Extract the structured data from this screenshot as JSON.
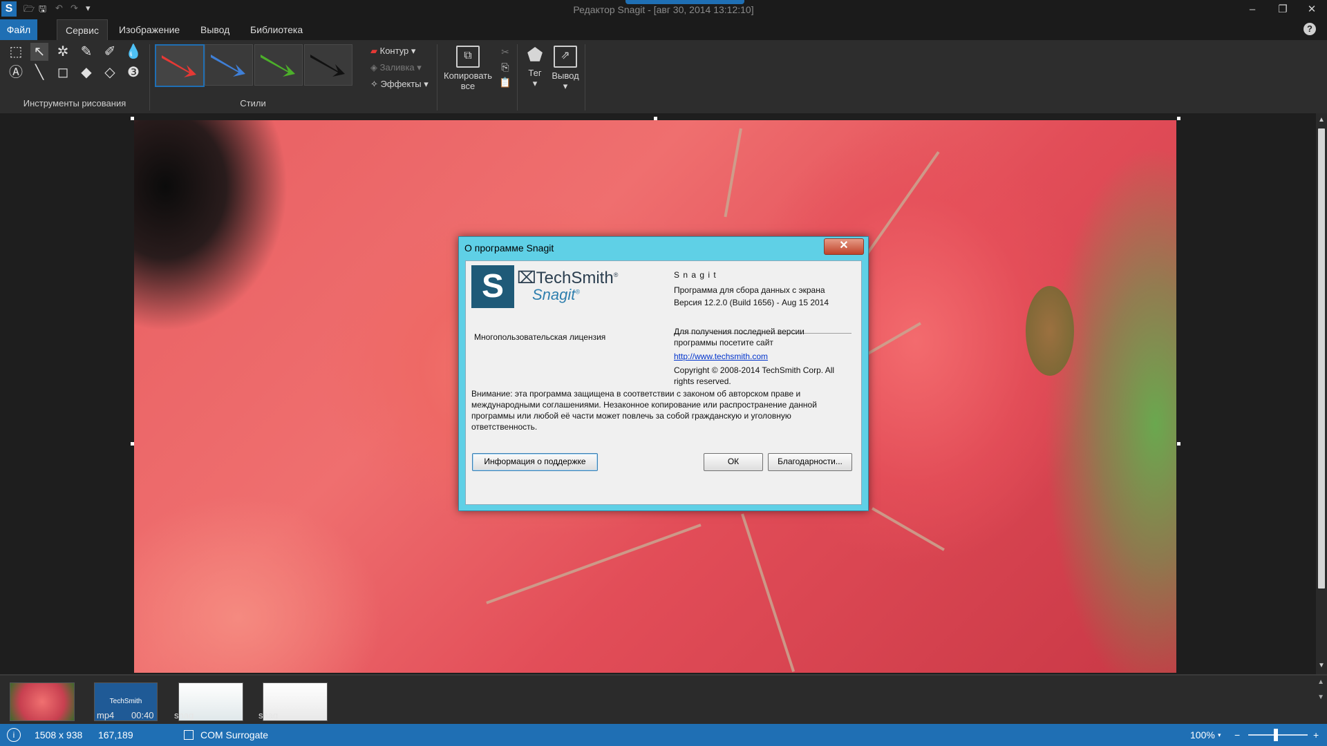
{
  "window": {
    "title": "Редактор Snagit - [авг 30, 2014 13:12:10]",
    "app_icon": "S",
    "quick_access": [
      "open-icon",
      "save-icon",
      "undo-icon",
      "redo-icon",
      "customize-icon"
    ],
    "controls": {
      "minimize": "–",
      "restore": "❐",
      "close": "✕"
    }
  },
  "menu": {
    "tabs": [
      "Файл",
      "Сервис",
      "Изображение",
      "Вывод",
      "Библиотека"
    ],
    "active": "Сервис",
    "help": "?"
  },
  "ribbon": {
    "drawing_tools_label": "Инструменты рисования",
    "drawing_tools": [
      "selection-icon",
      "arrow-icon",
      "stamp-icon",
      "pen-icon",
      "highlighter-icon",
      "blur-icon",
      "callout-icon",
      "line-icon",
      "shape-icon",
      "fill-icon",
      "eraser-icon",
      "step-icon"
    ],
    "styles_label": "Стили",
    "styles": [
      {
        "name": "red-arrow",
        "color": "#e53935"
      },
      {
        "name": "blue-arrow",
        "color": "#3f7fd6"
      },
      {
        "name": "green-arrow",
        "color": "#4caf2a"
      },
      {
        "name": "black-arrow",
        "color": "#111111"
      }
    ],
    "contour_label": "Контур",
    "fill_label": "Заливка",
    "effects_label": "Эффекты",
    "copy_all_label_1": "Копировать",
    "copy_all_label_2": "все",
    "tag_label": "Тег",
    "output_label": "Вывод"
  },
  "dialog": {
    "title": "О программе Snagit",
    "close": "✕",
    "logo_s": "S",
    "logo_company": "TechSmith",
    "logo_product": "Snagit",
    "product_name": "S n a g i t",
    "description": "Программа для сбора данных с экрана",
    "version": "Версия 12.2.0 (Build 1656) - Aug 15 2014",
    "license": "Многопользовательская лицензия",
    "latest_version_line1": "Для получения последней версии",
    "latest_version_line2": "программы посетите сайт",
    "url": "http://www.techsmith.com",
    "copyright_line1": "Copyright © 2008-2014 TechSmith Corp. All",
    "copyright_line2": "rights reserved.",
    "warning_line1": "Внимание: эта программа защищена в соответствии с законом об авторском праве и",
    "warning_line2": "международными соглашениями. Незаконное копирование или распространение данной",
    "warning_line3": "программы или любой её части может повлечь за собой гражданскую и уголовную",
    "warning_line4": "ответственность.",
    "support_button": "Информация о поддержке",
    "ok_button": "ОК",
    "thanks_button": "Благодарности..."
  },
  "tray": {
    "items": [
      {
        "label": "",
        "kind": "image"
      },
      {
        "label": "mp4",
        "duration": "00:40",
        "brand": "TechSmith"
      },
      {
        "label": "snag"
      },
      {
        "label": "snag"
      }
    ]
  },
  "status": {
    "info_icon": "i",
    "dimensions": "1508 x 938",
    "cursor": "167,189",
    "process": "COM Surrogate",
    "zoom": "100%",
    "zoom_out": "−",
    "zoom_in": "+"
  }
}
